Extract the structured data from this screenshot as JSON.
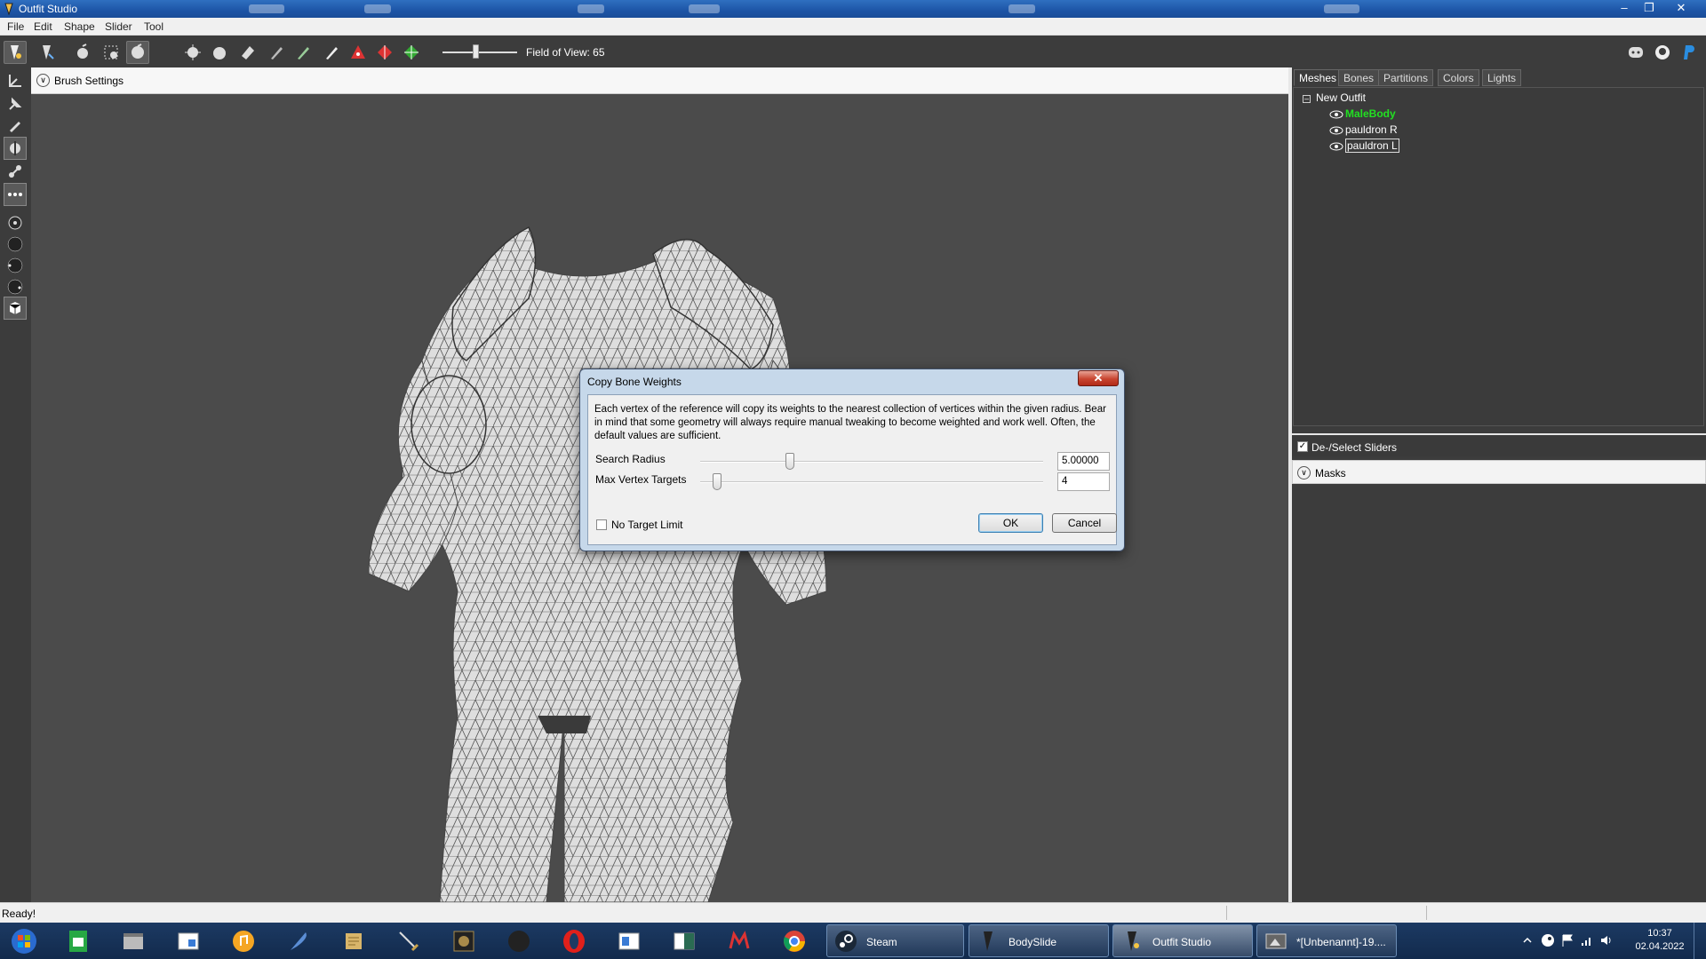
{
  "window": {
    "title": "Outfit Studio"
  },
  "menu": [
    "File",
    "Edit",
    "Shape",
    "Slider",
    "Tool"
  ],
  "toolbar": {
    "fov_label": "Field of View: 65"
  },
  "brush_settings": {
    "label": "Brush Settings"
  },
  "right_panel": {
    "tabs": [
      "Meshes",
      "Bones",
      "Partitions",
      "Colors",
      "Lights"
    ],
    "active_tab": "Meshes",
    "tree": {
      "root": "New Outfit",
      "items": [
        {
          "label": "MaleBody",
          "color": "#22e022"
        },
        {
          "label": "pauldron R",
          "color": "#ffffff"
        },
        {
          "label": "pauldron L",
          "color": "#ffffff"
        }
      ]
    },
    "sliders_label": "De-/Select Sliders",
    "sliders_checked": "✓",
    "masks_label": "Masks"
  },
  "status": {
    "text": "Ready!"
  },
  "dialog": {
    "title": "Copy Bone Weights",
    "description": "Each vertex of the reference will copy its weights to the nearest collection of vertices within the given radius. Bear in mind that some geometry will always require manual tweaking to become weighted and work well. Often, the default values are sufficient.",
    "search_radius_label": "Search Radius",
    "search_radius_value": "5.00000",
    "max_vertex_label": "Max Vertex Targets",
    "max_vertex_value": "4",
    "no_limit_label": "No Target Limit",
    "ok": "OK",
    "cancel": "Cancel"
  },
  "taskbar": {
    "windows": [
      "Steam",
      "BodySlide",
      "Outfit Studio",
      "*[Unbenannt]-19...."
    ],
    "active_window": "Outfit Studio",
    "time": "10:37",
    "date": "02.04.2022"
  }
}
